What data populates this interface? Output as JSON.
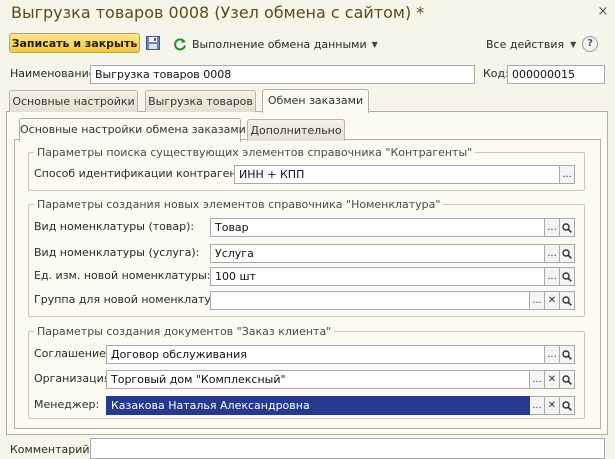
{
  "window": {
    "title": "Выгрузка товаров 0008 (Узел обмена с сайтом) *",
    "close_glyph": "×"
  },
  "toolbar": {
    "save_close_label": "Записать и закрыть",
    "save_icon": "floppy-disk-icon",
    "exchange_label": "Выполнение обмена данными",
    "all_actions_label": "Все действия",
    "help_label": "?"
  },
  "header": {
    "name_label": "Наименование:",
    "name_value": "Выгрузка товаров 0008",
    "code_label": "Код:",
    "code_value": "000000015"
  },
  "tabs": [
    {
      "label": "Основные настройки",
      "active": false
    },
    {
      "label": "Выгрузка товаров",
      "active": false
    },
    {
      "label": "Обмен заказами",
      "active": true
    }
  ],
  "subtabs": [
    {
      "label": "Основные настройки обмена заказами",
      "active": true
    },
    {
      "label": "Дополнительно",
      "active": false
    }
  ],
  "group_contractors": {
    "title": "Параметры поиска существующих элементов справочника \"Контрагенты\"",
    "id_method_label": "Способ идентификации контрагентов:",
    "id_method_value": "ИНН + КПП"
  },
  "group_nomenclature": {
    "title": "Параметры создания новых элементов справочника \"Номенклатура\"",
    "fields": [
      {
        "label": "Вид номенклатуры (товар):",
        "value": "Товар"
      },
      {
        "label": "Вид номенклатуры (услуга):",
        "value": "Услуга"
      },
      {
        "label": "Ед. изм. новой номенклатуры:",
        "value": "100 шт"
      },
      {
        "label": "Группа для новой номенклатуры:",
        "value": ""
      }
    ]
  },
  "group_order": {
    "title": "Параметры создания документов \"Заказ клиента\"",
    "fields": [
      {
        "label": "Соглашение:",
        "value": "Договор обслуживания"
      },
      {
        "label": "Организация:",
        "value": "Торговый дом \"Комплексный\""
      },
      {
        "label": "Менеджер:",
        "value": "Казакова Наталья Александровна"
      }
    ]
  },
  "comment": {
    "label": "Комментарий:",
    "value": ""
  },
  "glyphs": {
    "ellipsis": "...",
    "clear": "✕"
  },
  "colors": {
    "primary_button": "#f0c94a",
    "title_text": "#5d4c17",
    "selection": "#24398f",
    "panel_bg": "#fbfbf4",
    "window_bg": "#f6f5ea"
  }
}
